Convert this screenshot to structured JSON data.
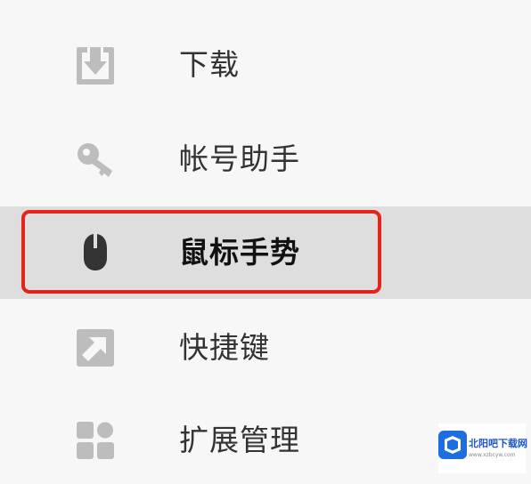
{
  "menu": {
    "items": [
      {
        "label": "下载",
        "icon": "download-icon"
      },
      {
        "label": "帐号助手",
        "icon": "key-icon"
      },
      {
        "label": "鼠标手势",
        "icon": "mouse-icon",
        "active": true
      },
      {
        "label": "快捷键",
        "icon": "shortcut-arrow-icon"
      },
      {
        "label": "扩展管理",
        "icon": "extensions-grid-icon"
      }
    ]
  },
  "colors": {
    "icon_gray": "#bdbdbd",
    "icon_dark": "#333333",
    "highlight_border": "#e4241b",
    "active_background": "#dedede"
  },
  "watermark": {
    "title": "北阳吧下载网",
    "subtitle": "www.xzbcyw.com"
  }
}
